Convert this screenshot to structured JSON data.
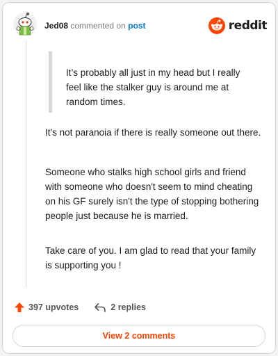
{
  "comment": {
    "username": "Jed08",
    "action_text": "commented on",
    "post_link": "post",
    "quote": "It’s probably all just in my head but I really feel like the stalker guy is around me at random times.",
    "paragraphs": [
      "It's not paranoia if there is really someone out there.",
      "Someone who stalks high school girls and friend with someone who doesn't seem to mind cheating on his GF surely isn't the type of stopping bothering people just because he is married.",
      "Take care of you. I am glad to read that your family is supporting you !"
    ]
  },
  "brand": {
    "wordmark": "reddit",
    "icon": "reddit-logo-icon",
    "color": "#ff4500"
  },
  "footer": {
    "upvotes": "397 upvotes",
    "replies": "2 replies",
    "view_comments": "View 2 comments"
  },
  "icons": {
    "avatar": "snoo-avatar-icon",
    "upvote": "upvote-arrow-icon",
    "reply": "reply-arrow-icon"
  },
  "colors": {
    "accent": "#ff4500",
    "link": "#0079d3",
    "text": "#1c1c1c",
    "muted": "#7c7c7c"
  }
}
